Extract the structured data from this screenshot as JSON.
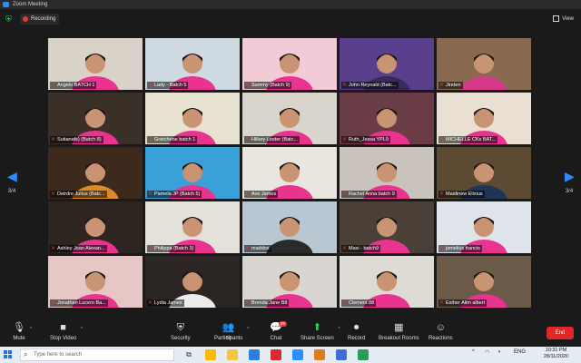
{
  "window": {
    "title": "Zoom Meeting"
  },
  "topbar": {
    "recording_label": "Recording",
    "view_label": "View"
  },
  "gallery": {
    "page_left": "3/4",
    "page_right": "3/4",
    "participants": [
      {
        "name": "Angelo BATCH 1",
        "bg": "#d8d2c8",
        "shirt": "#e8338f"
      },
      {
        "name": "Lady - Batch 5",
        "bg": "#cfd9e2",
        "shirt": "#e8338f"
      },
      {
        "name": "Sammy (Batch 9)",
        "bg": "#f2cbd6",
        "shirt": "#e8338f"
      },
      {
        "name": "John Reynald (Batc...",
        "bg": "#5a3f8c",
        "shirt": "#3a2a5c"
      },
      {
        "name": "Jireten",
        "bg": "#8a6a4e",
        "shirt": "#d63a8a"
      },
      {
        "name": "Sutianafs) (Batch 8)",
        "bg": "#3a3028",
        "shirt": "#e8338f"
      },
      {
        "name": "Gretchene batch 1",
        "bg": "#e8e2d0",
        "shirt": "#e8338f"
      },
      {
        "name": "Hillary Lester (Batc...",
        "bg": "#d9d4cc",
        "shirt": "#e8338f"
      },
      {
        "name": "Ruth_Jessa YPL9",
        "bg": "#6a3c46",
        "shirt": "#e8338f"
      },
      {
        "name": "MICHELLE CKs BAT...",
        "bg": "#e9dfd2",
        "shirt": "#e8338f"
      },
      {
        "name": "Deirdre Julius (Batc...",
        "bg": "#3d2a1c",
        "shirt": "#d98a2a"
      },
      {
        "name": "Pamela JP (Batch 5)",
        "bg": "#3aa0d8",
        "shirt": "#e8338f"
      },
      {
        "name": "Ave James",
        "bg": "#e9e6df",
        "shirt": "#e8338f"
      },
      {
        "name": "Rachel Anna batch 9",
        "bg": "#c9c3bb",
        "shirt": "#e8338f"
      },
      {
        "name": "Maidinew Elixius",
        "bg": "#5c4a33",
        "shirt": "#1f3554"
      },
      {
        "name": "Ashley Joan Alexan...",
        "bg": "#2e2520",
        "shirt": "#e8338f"
      },
      {
        "name": "Philippa (Batch 3)",
        "bg": "#e4e0da",
        "shirt": "#e8338f"
      },
      {
        "name": "maddox",
        "bg": "#b9c7d2",
        "shirt": "#2a2a2a"
      },
      {
        "name": "Maxi - batch9",
        "bg": "#4a4038",
        "shirt": "#e8338f"
      },
      {
        "name": "jomelius francis",
        "bg": "#dfe4ea",
        "shirt": "#e8338f"
      },
      {
        "name": "Jonathan Lucero Ba...",
        "bg": "#e7c6c6",
        "shirt": "#e8338f"
      },
      {
        "name": "Lydia James",
        "bg": "#2b2623",
        "shirt": "#ececec"
      },
      {
        "name": "Brenda Jane B8",
        "bg": "#d9d5d0",
        "shirt": "#e8338f"
      },
      {
        "name": "Clement 88",
        "bg": "#dedad4",
        "shirt": "#e8338f"
      },
      {
        "name": "Esther Alim albert",
        "bg": "#6b5a48",
        "shirt": "#e8338f"
      }
    ]
  },
  "toolbar": {
    "mute": "Mute",
    "stop_video": "Stop Video",
    "security": "Security",
    "participants": "Participants",
    "participants_count": "89",
    "chat": "Chat",
    "chat_badge": "99",
    "share_screen": "Share Screen",
    "record": "Record",
    "breakout": "Breakout Rooms",
    "reactions": "Reactions",
    "end": "End"
  },
  "taskbar": {
    "search_placeholder": "Type here to search",
    "lang": "ENG",
    "time": "10:31 PM",
    "date": "28/11/2020"
  },
  "colors": {
    "accent": "#2d8cff",
    "end_red": "#e02828",
    "share_green": "#23d959",
    "shirt_pink": "#e8338f"
  }
}
